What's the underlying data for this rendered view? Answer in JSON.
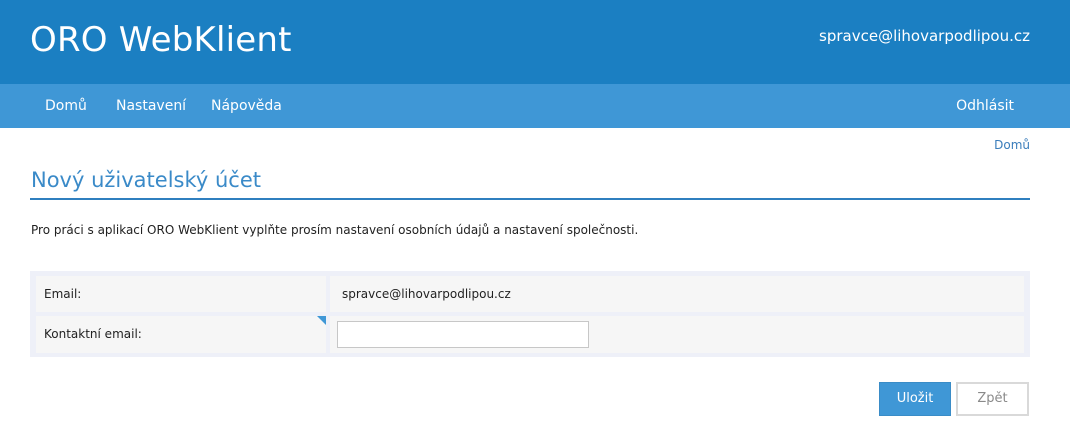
{
  "header": {
    "app_title": "ORO WebKlient",
    "user_email": "spravce@lihovarpodlipou.cz"
  },
  "nav": {
    "home": "Domů",
    "settings": "Nastavení",
    "help": "Nápověda",
    "logout": "Odhlásit"
  },
  "breadcrumb": {
    "home": "Domů"
  },
  "page": {
    "title": "Nový uživatelský účet",
    "intro": "Pro práci s aplikací ORO WebKlient vyplňte prosím nastavení osobních údajů a nastavení společnosti."
  },
  "form": {
    "email_label": "Email:",
    "email_value": "spravce@lihovarpodlipou.cz",
    "contact_email_label": "Kontaktní email:",
    "contact_email_value": ""
  },
  "actions": {
    "save_label": "Uložit",
    "back_label": "Zpět"
  },
  "colors": {
    "header_bg": "#1b7fc2",
    "nav_bg": "#3f97d6",
    "title": "#3a8ac8",
    "primary_button": "#3f97d6"
  }
}
